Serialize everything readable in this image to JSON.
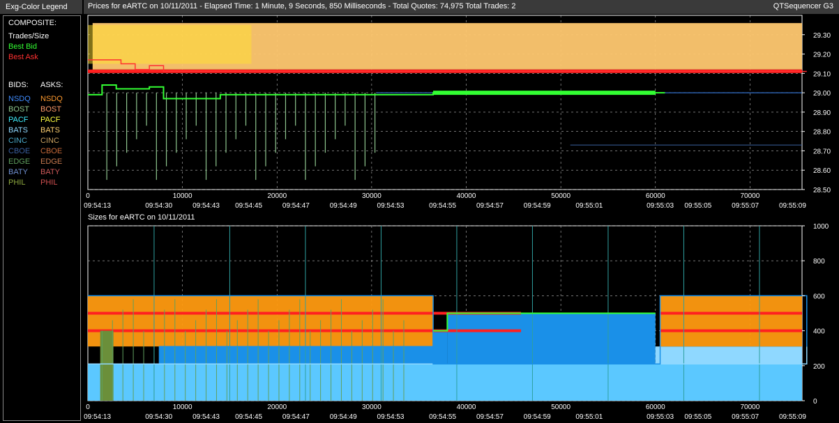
{
  "legend": {
    "title": "Exg-Color Legend",
    "composite_label": "COMPOSITE:",
    "composite": [
      {
        "label": "Trades/Size",
        "color": "#ffffff"
      },
      {
        "label": "Best Bid",
        "color": "#33ff33"
      },
      {
        "label": "Best Ask",
        "color": "#ff3030"
      }
    ],
    "bids_label": "BIDS:",
    "asks_label": "ASKS:",
    "exchanges": [
      {
        "bid": "NSDQ",
        "bid_color": "#3f8cff",
        "ask": "NSDQ",
        "ask_color": "#ff9a2e"
      },
      {
        "bid": "BOST",
        "bid_color": "#8fc78f",
        "ask": "BOST",
        "ask_color": "#ff9a6a"
      },
      {
        "bid": "PACF",
        "bid_color": "#3ff0ff",
        "ask": "PACF",
        "ask_color": "#ffff40"
      },
      {
        "bid": "BATS",
        "bid_color": "#8fd8ff",
        "ask": "BATS",
        "ask_color": "#ffd070"
      },
      {
        "bid": "CINC",
        "bid_color": "#4aa8c8",
        "ask": "CINC",
        "ask_color": "#c8a060"
      },
      {
        "bid": "CBOE",
        "bid_color": "#3a5fa0",
        "ask": "CBOE",
        "ask_color": "#c86a3a"
      },
      {
        "bid": "EDGE",
        "bid_color": "#5fa05f",
        "ask": "EDGE",
        "ask_color": "#c87a50"
      },
      {
        "bid": "BATY",
        "bid_color": "#6f8fd0",
        "ask": "BATY",
        "ask_color": "#d05a5a"
      },
      {
        "bid": "PHIL",
        "bid_color": "#8faa40",
        "ask": "PHIL",
        "ask_color": "#d05050"
      }
    ]
  },
  "header": {
    "title": "Prices for  eARTC  on  10/11/2011   -  Elapsed Time: 1 Minute, 9 Seconds, 850 Milliseconds   -  Total Quotes: 74,975  Total Trades: 2",
    "app_name": "QTSequencer G3",
    "sizes_title": "Sizes for  eARTC  on  10/11/2011"
  },
  "chart_data": [
    {
      "type": "line",
      "title": "Prices for  eARTC  on  10/11/2011",
      "x_range": [
        0,
        75500
      ],
      "ylim": [
        28.5,
        29.4
      ],
      "y_ticks": [
        "28.50",
        "28.60",
        "28.70",
        "28.80",
        "28.90",
        "29.00",
        "29.10",
        "29.20",
        "29.30"
      ],
      "y_tick_values": [
        28.5,
        28.6,
        28.7,
        28.8,
        28.9,
        29.0,
        29.1,
        29.2,
        29.3
      ],
      "x_ticks": [
        "0",
        "10000",
        "20000",
        "30000",
        "40000",
        "50000",
        "60000",
        "70000"
      ],
      "x_tick_values": [
        0,
        10000,
        20000,
        30000,
        40000,
        50000,
        60000,
        70000
      ],
      "time_labels": [
        "09:54:13",
        "09:54:30",
        "09:54:43",
        "09:54:45",
        "09:54:47",
        "09:54:49",
        "09:54:53",
        "09:54:55",
        "09:54:57",
        "09:54:59",
        "09:55:01",
        "09:55:03",
        "09:55:05",
        "09:55:07",
        "09:55:09"
      ],
      "time_label_x": [
        1000,
        7500,
        12500,
        17000,
        22000,
        27000,
        32000,
        37500,
        42500,
        47500,
        53000,
        60500,
        64500,
        69500,
        74500
      ],
      "grid": true,
      "series": [
        {
          "name": "Best Ask",
          "x": [
            0,
            3500,
            5000,
            6500,
            8000,
            76000
          ],
          "y": [
            29.17,
            29.15,
            29.12,
            29.14,
            29.11,
            29.11
          ]
        },
        {
          "name": "Best Bid",
          "x": [
            0,
            1500,
            3000,
            6500,
            8000,
            14000,
            36500,
            60000,
            61000
          ],
          "y": [
            28.99,
            29.04,
            29.02,
            29.03,
            28.97,
            28.99,
            29.0,
            29.0,
            29.0
          ]
        }
      ]
    },
    {
      "type": "area",
      "title": "Sizes for  eARTC  on  10/11/2011",
      "x_range": [
        0,
        75500
      ],
      "ylim": [
        0,
        1000
      ],
      "y_ticks": [
        "0",
        "200",
        "400",
        "600",
        "800",
        "1000"
      ],
      "y_tick_values": [
        0,
        200,
        400,
        600,
        800,
        1000
      ],
      "x_ticks": [
        "0",
        "10000",
        "20000",
        "30000",
        "40000",
        "50000",
        "60000",
        "70000"
      ],
      "x_tick_values": [
        0,
        10000,
        20000,
        30000,
        40000,
        50000,
        60000,
        70000
      ],
      "time_labels": [
        "09:54:13",
        "09:54:30",
        "09:54:43",
        "09:54:45",
        "09:54:47",
        "09:54:49",
        "09:54:53",
        "09:54:55",
        "09:54:57",
        "09:54:59",
        "09:55:01",
        "09:55:03",
        "09:55:05",
        "09:55:07",
        "09:55:09"
      ],
      "time_label_x": [
        1000,
        7500,
        12500,
        17000,
        22000,
        27000,
        32000,
        37500,
        42500,
        47500,
        53000,
        60500,
        64500,
        69500,
        74500
      ],
      "grid": true,
      "series": [
        {
          "name": "BATS",
          "x": [
            0,
            36500,
            60000,
            76000
          ],
          "y": [
            210,
            210,
            210,
            310
          ]
        },
        {
          "name": "NSDQ",
          "x": [
            7500,
            36500,
            38000,
            60000
          ],
          "y": [
            310,
            400,
            500,
            500
          ]
        },
        {
          "name": "NSDQ",
          "x": [
            0,
            36500,
            60500,
            76000
          ],
          "y": [
            600,
            210,
            600,
            310
          ]
        },
        {
          "name": "Best Bid",
          "x": [
            36500,
            38000,
            60000
          ],
          "y": [
            400,
            500,
            500
          ]
        }
      ]
    }
  ]
}
